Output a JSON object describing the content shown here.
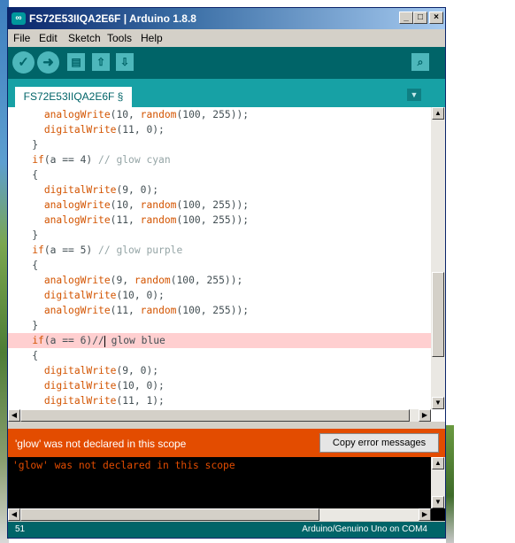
{
  "window": {
    "title": "FS72E53IIQA2E6F | Arduino 1.8.8",
    "logo_icon": "arduino-logo-icon",
    "controls": {
      "minimize": "_",
      "maximize": "□",
      "close": "×"
    }
  },
  "menubar": {
    "items": [
      "File",
      "Edit",
      "Sketch",
      "Tools",
      "Help"
    ]
  },
  "toolbar": {
    "buttons": [
      {
        "name": "verify",
        "icon": "check-icon",
        "glyph": "✓"
      },
      {
        "name": "upload",
        "icon": "arrow-right-icon",
        "glyph": "➜"
      },
      {
        "name": "new",
        "icon": "file-icon",
        "glyph": "▤"
      },
      {
        "name": "open",
        "icon": "arrow-up-icon",
        "glyph": "⇧"
      },
      {
        "name": "save",
        "icon": "arrow-down-icon",
        "glyph": "⇩"
      }
    ],
    "serial_monitor": {
      "icon": "magnifier-icon",
      "glyph": "⌕"
    }
  },
  "tabs": {
    "active": "FS72E53IIQA2E6F §",
    "menu_glyph": "▼"
  },
  "editor": {
    "lines": [
      {
        "parts": [
          [
            "    ",
            ""
          ],
          [
            "analogWrite",
            "fn"
          ],
          [
            "(10, ",
            ""
          ],
          [
            "random",
            "fn"
          ],
          [
            "(100, 255));",
            ""
          ]
        ]
      },
      {
        "parts": [
          [
            "    ",
            ""
          ],
          [
            "digitalWrite",
            "fn"
          ],
          [
            "(11, 0);",
            ""
          ]
        ]
      },
      {
        "parts": [
          [
            "  }",
            ""
          ]
        ]
      },
      {
        "parts": [
          [
            "  ",
            ""
          ],
          [
            "if",
            "kw"
          ],
          [
            "(a == 4) ",
            ""
          ],
          [
            "// glow cyan",
            "cm"
          ]
        ]
      },
      {
        "parts": [
          [
            "  {",
            ""
          ]
        ]
      },
      {
        "parts": [
          [
            "    ",
            ""
          ],
          [
            "digitalWrite",
            "fn"
          ],
          [
            "(9, 0);",
            ""
          ]
        ]
      },
      {
        "parts": [
          [
            "    ",
            ""
          ],
          [
            "analogWrite",
            "fn"
          ],
          [
            "(10, ",
            ""
          ],
          [
            "random",
            "fn"
          ],
          [
            "(100, 255));",
            ""
          ]
        ]
      },
      {
        "parts": [
          [
            "    ",
            ""
          ],
          [
            "analogWrite",
            "fn"
          ],
          [
            "(11, ",
            ""
          ],
          [
            "random",
            "fn"
          ],
          [
            "(100, 255));",
            ""
          ]
        ]
      },
      {
        "parts": [
          [
            "  }",
            ""
          ]
        ]
      },
      {
        "parts": [
          [
            "  ",
            ""
          ],
          [
            "if",
            "kw"
          ],
          [
            "(a == 5) ",
            ""
          ],
          [
            "// glow purple",
            "cm"
          ]
        ]
      },
      {
        "parts": [
          [
            "  {",
            ""
          ]
        ]
      },
      {
        "parts": [
          [
            "    ",
            ""
          ],
          [
            "analogWrite",
            "fn"
          ],
          [
            "(9, ",
            ""
          ],
          [
            "random",
            "fn"
          ],
          [
            "(100, 255));",
            ""
          ]
        ]
      },
      {
        "parts": [
          [
            "    ",
            ""
          ],
          [
            "digitalWrite",
            "fn"
          ],
          [
            "(10, 0);",
            ""
          ]
        ]
      },
      {
        "parts": [
          [
            "    ",
            ""
          ],
          [
            "analogWrite",
            "fn"
          ],
          [
            "(11, ",
            ""
          ],
          [
            "random",
            "fn"
          ],
          [
            "(100, 255));",
            ""
          ]
        ]
      },
      {
        "parts": [
          [
            "  }",
            ""
          ]
        ]
      },
      {
        "parts": [
          [
            "  ",
            ""
          ],
          [
            "if",
            "kw"
          ],
          [
            "(a == 6)//",
            ""
          ],
          [
            "|",
            "caret"
          ],
          [
            " glow blue",
            ""
          ]
        ],
        "highlight": true
      },
      {
        "parts": [
          [
            "  {",
            ""
          ]
        ]
      },
      {
        "parts": [
          [
            "    ",
            ""
          ],
          [
            "digitalWrite",
            "fn"
          ],
          [
            "(9, 0);",
            ""
          ]
        ]
      },
      {
        "parts": [
          [
            "    ",
            ""
          ],
          [
            "digitalWrite",
            "fn"
          ],
          [
            "(10, 0);",
            ""
          ]
        ]
      },
      {
        "parts": [
          [
            "    ",
            ""
          ],
          [
            "digitalWrite",
            "fn"
          ],
          [
            "(11, 1);",
            ""
          ]
        ]
      }
    ]
  },
  "error_bar": {
    "message": "'glow' was not declared in this scope",
    "copy_button": "Copy error messages"
  },
  "console": {
    "text": "'glow' was not declared in this scope"
  },
  "statusbar": {
    "line_number": "51",
    "board": "Arduino/Genuino Uno on COM4"
  },
  "colors": {
    "teal_dark": "#006468",
    "teal_light": "#17a1a5",
    "error_orange": "#e34c00",
    "line_highlight": "#ffcfd0"
  }
}
